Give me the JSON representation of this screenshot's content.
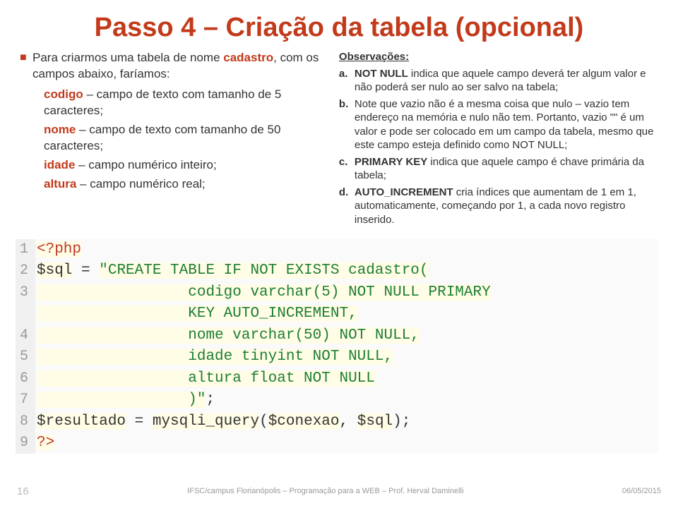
{
  "title": "Passo 4 – Criação da tabela (opcional)",
  "left": {
    "intro_a": "Para criarmos uma tabela de nome ",
    "intro_b": "cadastro",
    "intro_c": ", com os campos abaixo, faríamos:",
    "f1k": "codigo",
    "f1t": " – campo de texto com tamanho de 5 caracteres;",
    "f2k": "nome",
    "f2t": " – campo de texto com tamanho de 50 caracteres;",
    "f3k": "idade",
    "f3t": " – campo numérico inteiro;",
    "f4k": "altura",
    "f4t": " – campo numérico real;"
  },
  "right": {
    "head": "Observações:",
    "a_lbl": "a.",
    "a_k": "NOT NULL",
    "a_t": " indica que aquele campo deverá ter algum valor e não poderá ser nulo ao ser salvo na tabela;",
    "b_lbl": "b.",
    "b_t": "Note que vazio não é a mesma coisa que nulo – vazio tem endereço na memória e nulo não tem. Portanto, vazio \"\" é um valor e pode ser colocado em um campo da tabela, mesmo que este campo esteja definido como NOT NULL;",
    "c_lbl": "c.",
    "c_k": "PRIMARY KEY",
    "c_t": " indica que aquele campo é chave primária da tabela;",
    "d_lbl": "d.",
    "d_k": "AUTO_INCREMENT",
    "d_t": " cria índices que aumentam de 1 em 1, automaticamente, começando por 1, a cada novo registro inserido."
  },
  "code": {
    "l1n": "1",
    "l1a": "<?php",
    "l2n": "2",
    "l2a": "$sql",
    "l2b": " = ",
    "l2c": "\"CREATE TABLE IF NOT EXISTS cadastro(",
    "l3n": "3",
    "l3a": "                 codigo varchar(5) NOT NULL PRIMARY",
    "l3b": "                 KEY AUTO_INCREMENT,",
    "l4n": "4",
    "l4a": "                 nome varchar(50) NOT NULL,",
    "l5n": "5",
    "l5a": "                 idade tinyint NOT NULL,",
    "l6n": "6",
    "l6a": "                 altura float NOT NULL",
    "l7n": "7",
    "l7a": "                 )\"",
    "l7b": ";",
    "l8n": "8",
    "l8a": "$resultado",
    "l8b": " = ",
    "l8c": "mysqli_query",
    "l8d": "(",
    "l8e": "$conexao",
    "l8f": ", ",
    "l8g": "$sql",
    "l8h": ");",
    "l9n": "9",
    "l9a": "?>"
  },
  "footer": {
    "page": "16",
    "center": "IFSC/campus Florianópolis – Programação para a WEB – Prof. Herval Daminelli",
    "date": "06/05/2015"
  }
}
